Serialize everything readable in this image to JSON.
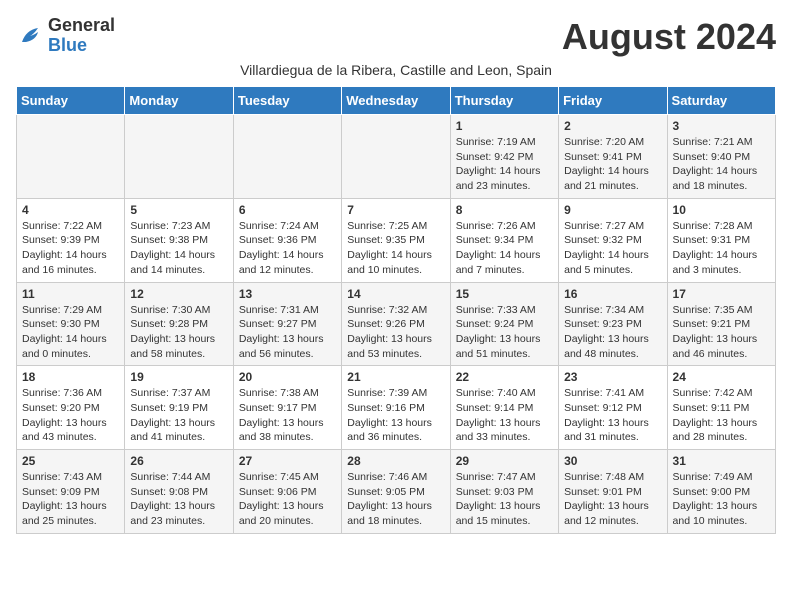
{
  "header": {
    "logo_general": "General",
    "logo_blue": "Blue",
    "month_title": "August 2024",
    "subtitle": "Villardiegua de la Ribera, Castille and Leon, Spain"
  },
  "weekdays": [
    "Sunday",
    "Monday",
    "Tuesday",
    "Wednesday",
    "Thursday",
    "Friday",
    "Saturday"
  ],
  "weeks": [
    [
      {
        "day": "",
        "info": ""
      },
      {
        "day": "",
        "info": ""
      },
      {
        "day": "",
        "info": ""
      },
      {
        "day": "",
        "info": ""
      },
      {
        "day": "1",
        "info": "Sunrise: 7:19 AM\nSunset: 9:42 PM\nDaylight: 14 hours and 23 minutes."
      },
      {
        "day": "2",
        "info": "Sunrise: 7:20 AM\nSunset: 9:41 PM\nDaylight: 14 hours and 21 minutes."
      },
      {
        "day": "3",
        "info": "Sunrise: 7:21 AM\nSunset: 9:40 PM\nDaylight: 14 hours and 18 minutes."
      }
    ],
    [
      {
        "day": "4",
        "info": "Sunrise: 7:22 AM\nSunset: 9:39 PM\nDaylight: 14 hours and 16 minutes."
      },
      {
        "day": "5",
        "info": "Sunrise: 7:23 AM\nSunset: 9:38 PM\nDaylight: 14 hours and 14 minutes."
      },
      {
        "day": "6",
        "info": "Sunrise: 7:24 AM\nSunset: 9:36 PM\nDaylight: 14 hours and 12 minutes."
      },
      {
        "day": "7",
        "info": "Sunrise: 7:25 AM\nSunset: 9:35 PM\nDaylight: 14 hours and 10 minutes."
      },
      {
        "day": "8",
        "info": "Sunrise: 7:26 AM\nSunset: 9:34 PM\nDaylight: 14 hours and 7 minutes."
      },
      {
        "day": "9",
        "info": "Sunrise: 7:27 AM\nSunset: 9:32 PM\nDaylight: 14 hours and 5 minutes."
      },
      {
        "day": "10",
        "info": "Sunrise: 7:28 AM\nSunset: 9:31 PM\nDaylight: 14 hours and 3 minutes."
      }
    ],
    [
      {
        "day": "11",
        "info": "Sunrise: 7:29 AM\nSunset: 9:30 PM\nDaylight: 14 hours and 0 minutes."
      },
      {
        "day": "12",
        "info": "Sunrise: 7:30 AM\nSunset: 9:28 PM\nDaylight: 13 hours and 58 minutes."
      },
      {
        "day": "13",
        "info": "Sunrise: 7:31 AM\nSunset: 9:27 PM\nDaylight: 13 hours and 56 minutes."
      },
      {
        "day": "14",
        "info": "Sunrise: 7:32 AM\nSunset: 9:26 PM\nDaylight: 13 hours and 53 minutes."
      },
      {
        "day": "15",
        "info": "Sunrise: 7:33 AM\nSunset: 9:24 PM\nDaylight: 13 hours and 51 minutes."
      },
      {
        "day": "16",
        "info": "Sunrise: 7:34 AM\nSunset: 9:23 PM\nDaylight: 13 hours and 48 minutes."
      },
      {
        "day": "17",
        "info": "Sunrise: 7:35 AM\nSunset: 9:21 PM\nDaylight: 13 hours and 46 minutes."
      }
    ],
    [
      {
        "day": "18",
        "info": "Sunrise: 7:36 AM\nSunset: 9:20 PM\nDaylight: 13 hours and 43 minutes."
      },
      {
        "day": "19",
        "info": "Sunrise: 7:37 AM\nSunset: 9:19 PM\nDaylight: 13 hours and 41 minutes."
      },
      {
        "day": "20",
        "info": "Sunrise: 7:38 AM\nSunset: 9:17 PM\nDaylight: 13 hours and 38 minutes."
      },
      {
        "day": "21",
        "info": "Sunrise: 7:39 AM\nSunset: 9:16 PM\nDaylight: 13 hours and 36 minutes."
      },
      {
        "day": "22",
        "info": "Sunrise: 7:40 AM\nSunset: 9:14 PM\nDaylight: 13 hours and 33 minutes."
      },
      {
        "day": "23",
        "info": "Sunrise: 7:41 AM\nSunset: 9:12 PM\nDaylight: 13 hours and 31 minutes."
      },
      {
        "day": "24",
        "info": "Sunrise: 7:42 AM\nSunset: 9:11 PM\nDaylight: 13 hours and 28 minutes."
      }
    ],
    [
      {
        "day": "25",
        "info": "Sunrise: 7:43 AM\nSunset: 9:09 PM\nDaylight: 13 hours and 25 minutes."
      },
      {
        "day": "26",
        "info": "Sunrise: 7:44 AM\nSunset: 9:08 PM\nDaylight: 13 hours and 23 minutes."
      },
      {
        "day": "27",
        "info": "Sunrise: 7:45 AM\nSunset: 9:06 PM\nDaylight: 13 hours and 20 minutes."
      },
      {
        "day": "28",
        "info": "Sunrise: 7:46 AM\nSunset: 9:05 PM\nDaylight: 13 hours and 18 minutes."
      },
      {
        "day": "29",
        "info": "Sunrise: 7:47 AM\nSunset: 9:03 PM\nDaylight: 13 hours and 15 minutes."
      },
      {
        "day": "30",
        "info": "Sunrise: 7:48 AM\nSunset: 9:01 PM\nDaylight: 13 hours and 12 minutes."
      },
      {
        "day": "31",
        "info": "Sunrise: 7:49 AM\nSunset: 9:00 PM\nDaylight: 13 hours and 10 minutes."
      }
    ]
  ]
}
